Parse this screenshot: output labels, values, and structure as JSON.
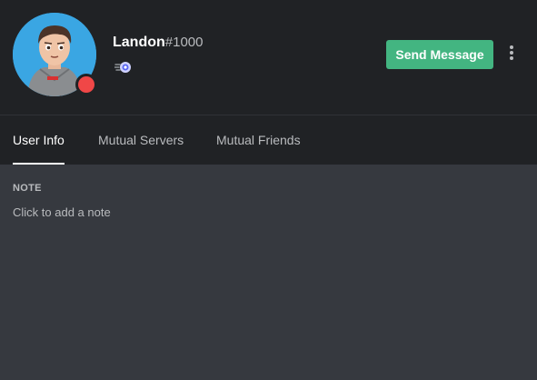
{
  "profile": {
    "username": "Landon",
    "discriminator": "#1000",
    "status": "Do Not Disturb",
    "badge_icon": "nitro-badge-icon"
  },
  "actions": {
    "send_message_label": "Send Message",
    "more_icon": "more-vertical-icon"
  },
  "tabs": [
    {
      "label": "User Info",
      "active": true
    },
    {
      "label": "Mutual Servers",
      "active": false
    },
    {
      "label": "Mutual Friends",
      "active": false
    }
  ],
  "note": {
    "heading": "NOTE",
    "placeholder": "Click to add a note"
  },
  "colors": {
    "header_bg": "#202225",
    "body_bg": "#36393f",
    "button_green": "#43b581",
    "status_red": "#f04747",
    "text_muted": "#b9bbbe"
  }
}
